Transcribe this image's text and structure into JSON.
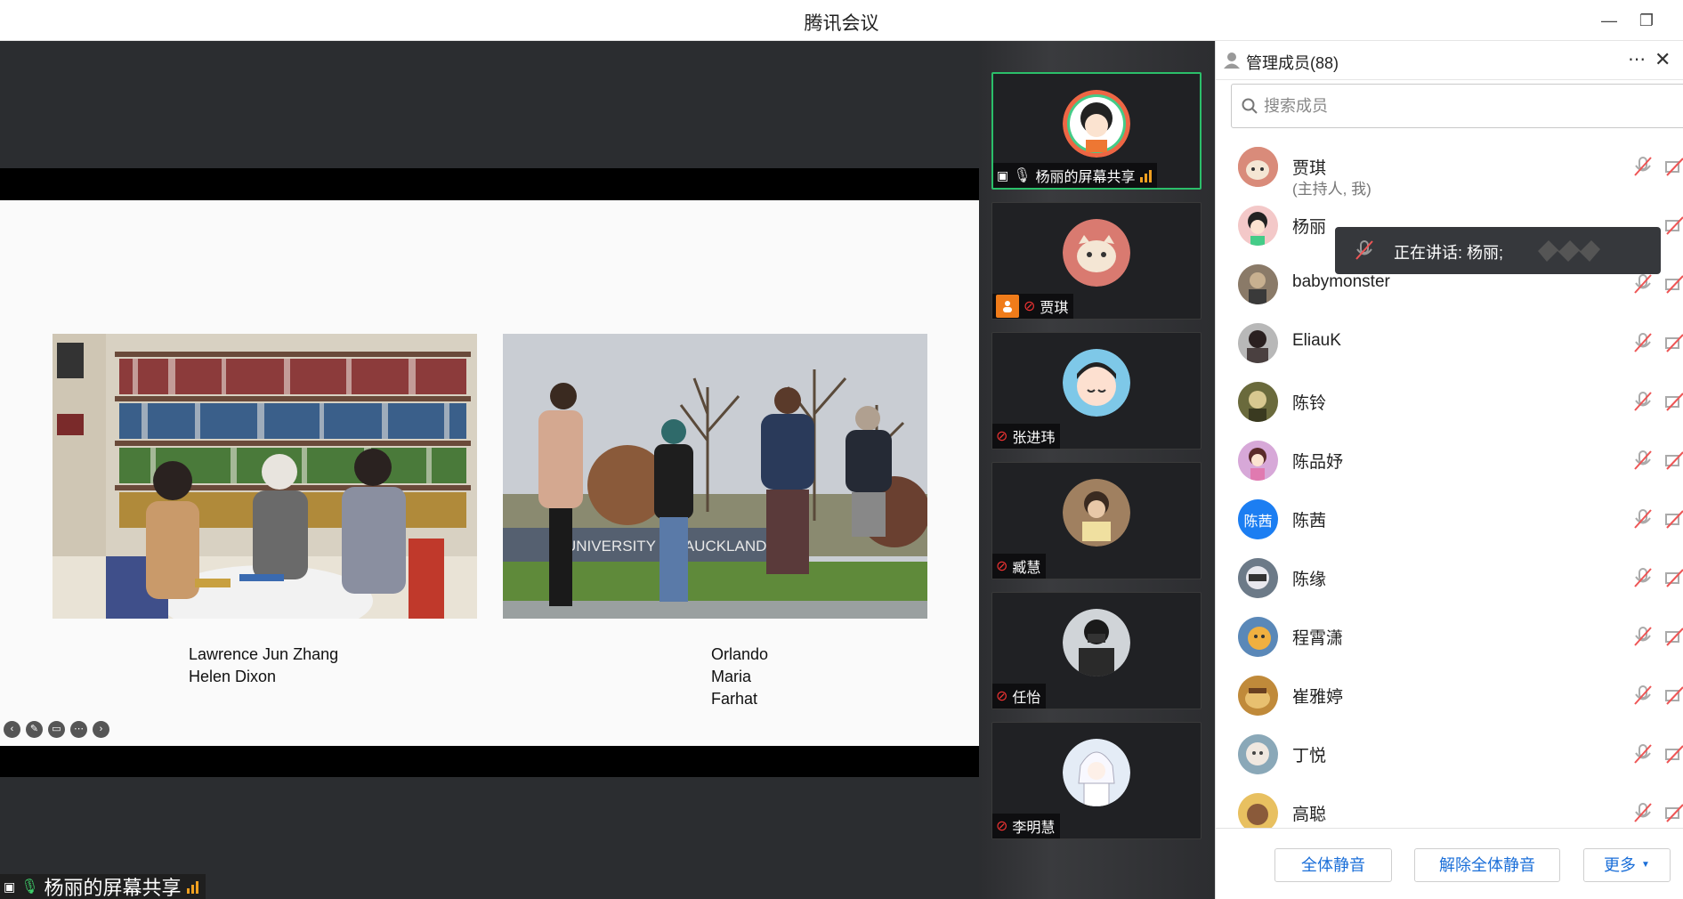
{
  "window": {
    "title": "腾讯会议"
  },
  "slide": {
    "left_caption": [
      "Lawrence Jun Zhang",
      "Helen Dixon"
    ],
    "right_caption": [
      "Orlando",
      "Maria",
      "Farhat"
    ],
    "photo_sign_text": "UNIVERSITY OF AUCKLAND"
  },
  "presenter_tag": {
    "label": "杨丽的屏幕共享"
  },
  "gallery": [
    {
      "name": "杨丽的屏幕共享",
      "active": true
    },
    {
      "name": "贾琪",
      "host": true
    },
    {
      "name": "张进玮"
    },
    {
      "name": "臧慧"
    },
    {
      "name": "任怡"
    },
    {
      "name": "李明慧"
    }
  ],
  "panel": {
    "title": "管理成员(88)",
    "search_placeholder": "搜索成员",
    "speaking": "正在讲话: 杨丽;",
    "members": [
      {
        "name": "贾琪",
        "sub": "(主持人, 我)",
        "avatar_color": "#d98b7a"
      },
      {
        "name": "杨丽",
        "avatar_color": "#f3c8c8"
      },
      {
        "name": "babymonster",
        "avatar_color": "#8a7a68"
      },
      {
        "name": "EliauK",
        "avatar_color": "#4a4040"
      },
      {
        "name": "陈铃",
        "avatar_color": "#6a6a3c"
      },
      {
        "name": "陈品妤",
        "avatar_color": "#d7a8d8"
      },
      {
        "name": "陈茜",
        "avatar_color": "#1c7ef2",
        "avatar_text": "陈茜"
      },
      {
        "name": "陈缘",
        "avatar_color": "#6c7a88"
      },
      {
        "name": "程霄潇",
        "avatar_color": "#5a88b8"
      },
      {
        "name": "崔雅婷",
        "avatar_color": "#c08a3a"
      },
      {
        "name": "丁悦",
        "avatar_color": "#8aa8b8"
      },
      {
        "name": "高聪",
        "avatar_color": "#e8c060"
      }
    ],
    "buttons": {
      "mute_all": "全体静音",
      "unmute_all": "解除全体静音",
      "more": "更多"
    }
  }
}
